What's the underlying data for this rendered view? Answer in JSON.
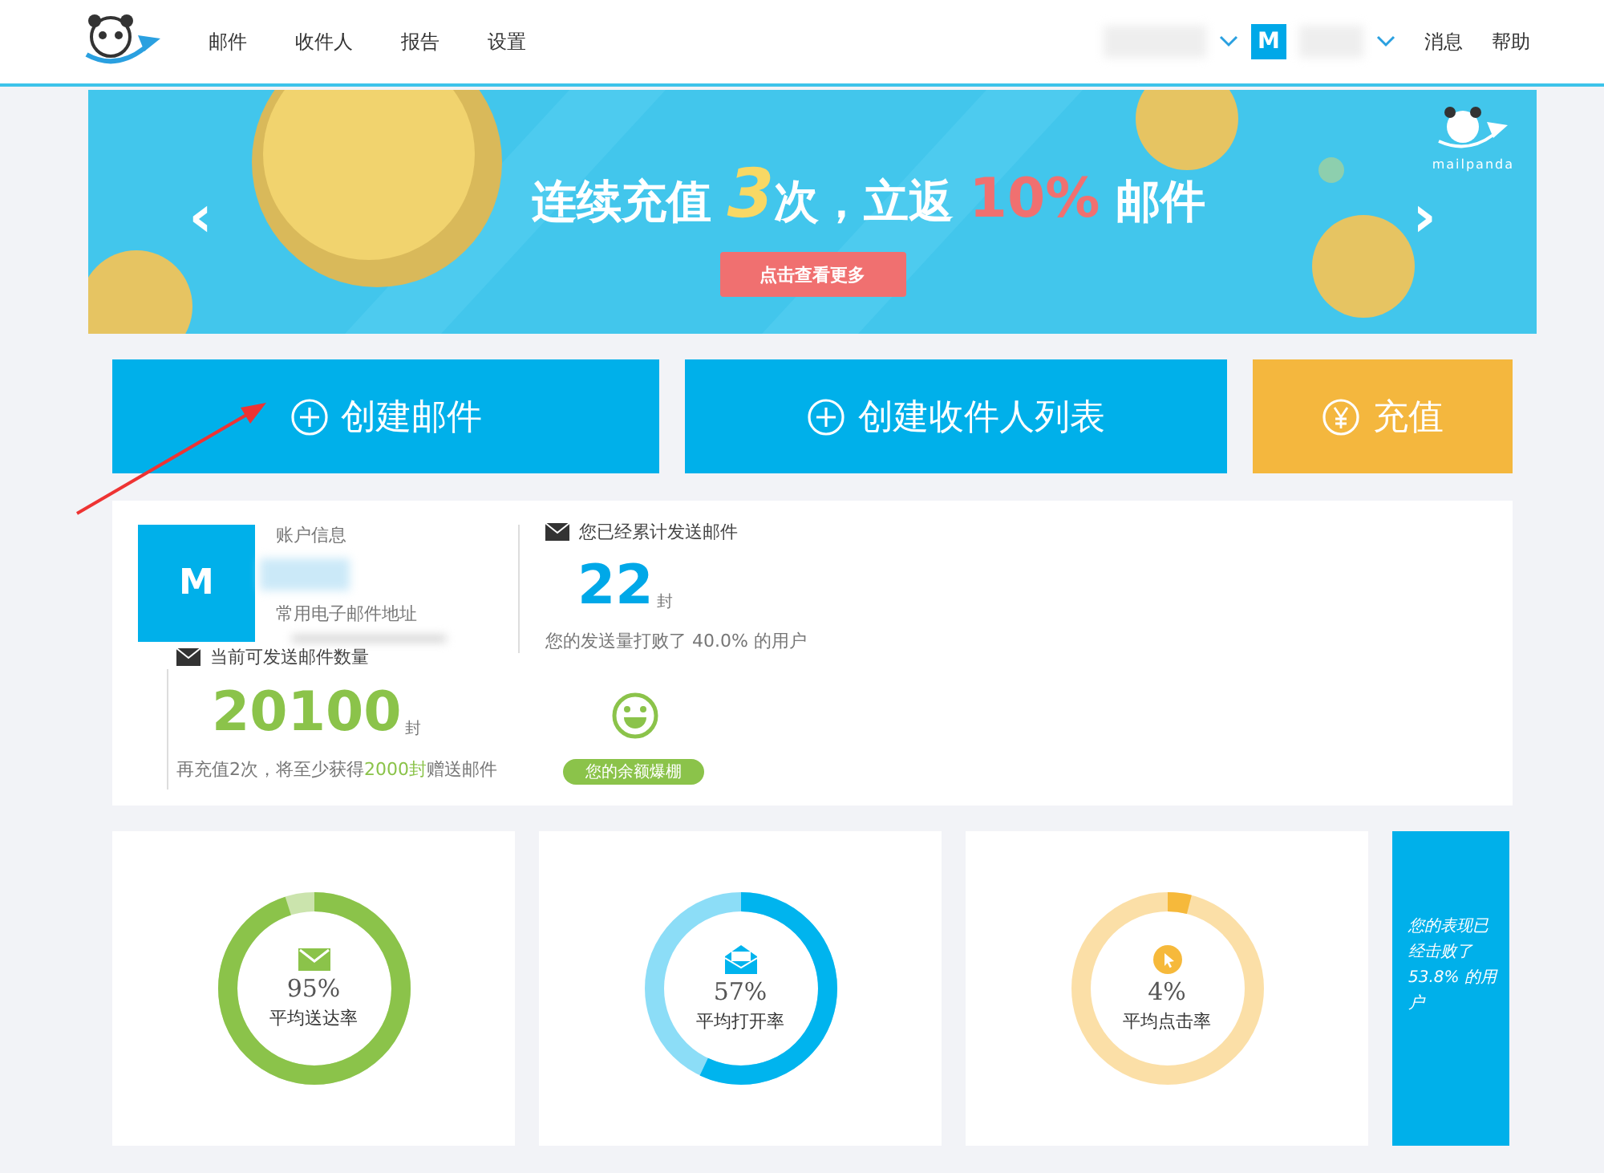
{
  "nav": {
    "links": [
      "邮件",
      "收件人",
      "报告",
      "设置"
    ],
    "avatar": "M",
    "right_links": [
      "消息",
      "帮助"
    ]
  },
  "banner": {
    "parts": [
      {
        "text": "连续充值 ",
        "kind": "plain"
      },
      {
        "text": "3",
        "kind": "yellow"
      },
      {
        "text": "次，立返 ",
        "kind": "plain"
      },
      {
        "text": "10%",
        "kind": "red"
      },
      {
        "text": " 邮件",
        "kind": "plain"
      }
    ],
    "button": "点击查看更多",
    "brand": "mailpanda",
    "prev": "‹",
    "next": "›"
  },
  "actions": [
    {
      "label": "创建邮件",
      "kind": "plus"
    },
    {
      "label": "创建收件人列表",
      "kind": "plus"
    },
    {
      "label": "充值",
      "kind": "yen"
    }
  ],
  "account": {
    "avatar": "M",
    "info_label": "账户信息",
    "email_label": "常用电子邮件地址",
    "sent_label": "您已经累计发送邮件",
    "sent_count": "22",
    "unit": "封",
    "sent_note": "您的发送量打败了 40.0% 的用户",
    "quota_label": "当前可发送邮件数量",
    "quota_count": "20100",
    "quota_unit": "封",
    "quota_note": "再充值2次，将至少获得**2000封**赠送邮件",
    "badge": "您的余额爆棚"
  },
  "stats": [
    {
      "value": "95%",
      "label": "平均送达率",
      "level": 0.95,
      "color": "#8bc34a",
      "kind": "mail"
    },
    {
      "value": "57%",
      "label": "平均打开率",
      "level": 0.57,
      "color": "#00b4ee",
      "kind": "open"
    },
    {
      "value": "4%",
      "label": "平均点击率",
      "level": 0.04,
      "color": "#f6b93b",
      "kind": "click"
    }
  ],
  "beat": "您的表现已经击败了53.8% 的用户"
}
